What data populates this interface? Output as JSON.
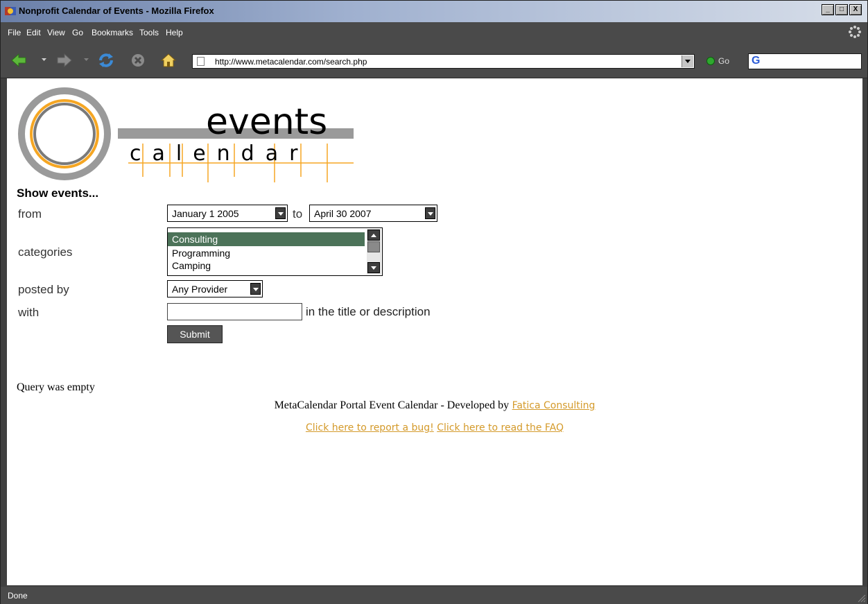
{
  "window": {
    "title": "Nonprofit Calendar of Events - Mozilla Firefox",
    "controls": [
      "_",
      "□",
      "X"
    ]
  },
  "menubar": {
    "items": [
      {
        "label": "File",
        "key": "F"
      },
      {
        "label": "Edit",
        "key": "E"
      },
      {
        "label": "View",
        "key": "V"
      },
      {
        "label": "Go",
        "key": "G"
      },
      {
        "label": "Bookmarks",
        "key": "B"
      },
      {
        "label": "Tools",
        "key": "T"
      },
      {
        "label": "Help",
        "key": "H"
      }
    ]
  },
  "navbar": {
    "url": "http://www.metacalendar.com/search.php",
    "go_label": "Go",
    "search_logo": "G"
  },
  "page": {
    "logo": {
      "word1": "events",
      "word2": "calendar"
    },
    "heading": "Show events...",
    "from_label": "from",
    "from_value": "January 1 2005",
    "to_label": "to",
    "to_value": "April 30 2007",
    "categories_label": "categories",
    "categories_options": [
      "Consulting",
      "Programming",
      "Camping"
    ],
    "categories_selected": "Consulting",
    "posted_by_label": "posted by",
    "posted_by_value": "Any Provider",
    "with_label": "with",
    "with_value": "",
    "with_suffix": "in the title or description",
    "submit_label": "Submit",
    "query_message": "Query was empty",
    "footer_text": "MetaCalendar Portal Event Calendar - Developed by",
    "footer_link": "Fatica Consulting",
    "bug_link": "Click here to report a bug!",
    "faq_link": "Click here to read the FAQ"
  },
  "statusbar": {
    "text": "Done"
  },
  "colors": {
    "chrome": "#4a4a4a",
    "link": "#d49a2a",
    "selected_option": "#4c7359",
    "logo_orange": "#f5a623",
    "logo_gray": "#9a9a9a"
  }
}
